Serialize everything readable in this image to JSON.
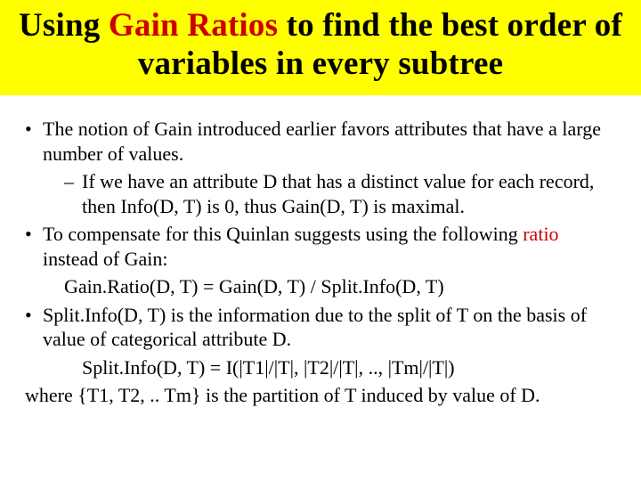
{
  "title": {
    "pre": "Using ",
    "highlight": "Gain Ratios",
    "post": " to find the best order of variables in every subtree"
  },
  "bullets": {
    "b1": "The notion of Gain introduced earlier favors attributes that have a large number of values.",
    "b1_dash": "If we have an attribute D that has a distinct value for each record, then Info(D, T) is 0, thus Gain(D, T) is maximal.",
    "b2_pre": "To compensate for this Quinlan suggests using the following ",
    "b2_red": "ratio",
    "b2_post": " instead of Gain:",
    "b2_eq": "Gain.Ratio(D, T) = Gain(D, T) / Split.Info(D, T)",
    "b3": "Split.Info(D, T) is the information due to the split of T on the basis of value of categorical attribute D.",
    "b3_eq": "Split.Info(D, T)  =  I(|T1|/|T|, |T2|/|T|, .., |Tm|/|T|)",
    "where": "where {T1, T2, .. Tm} is the partition of T induced by value of D."
  }
}
